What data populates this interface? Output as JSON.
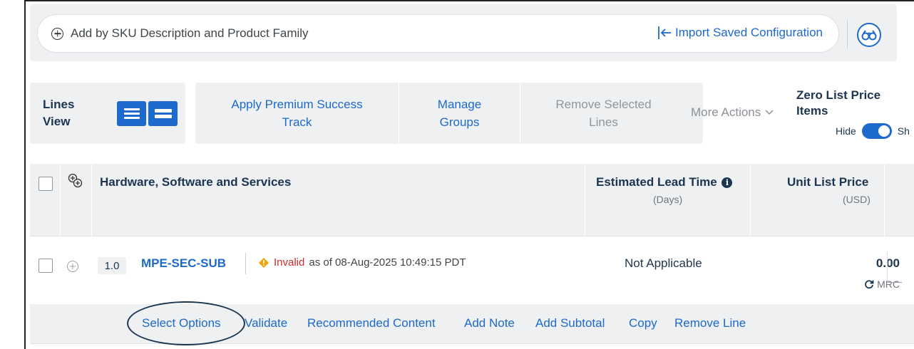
{
  "search": {
    "placeholder": "Add by SKU Description and Product Family",
    "import_label": "Import Saved Configuration"
  },
  "toolbar": {
    "lines_view_line1": "Lines",
    "lines_view_line2": "View",
    "apply_premium_line1": "Apply Premium Success",
    "apply_premium_line2": "Track",
    "manage_groups_line1": "Manage",
    "manage_groups_line2": "Groups",
    "remove_selected_line1": "Remove Selected",
    "remove_selected_line2": "Lines",
    "more_actions": "More Actions",
    "zero_list_line1": "Zero List Price",
    "zero_list_line2": "Items",
    "hide_label": "Hide",
    "show_label": "Sh"
  },
  "table": {
    "col_main": "Hardware, Software and Services",
    "col_lead": "Estimated Lead Time",
    "col_lead_sub": "(Days)",
    "col_price": "Unit List Price",
    "col_price_sub": "(USD)"
  },
  "row": {
    "line_number": "1.0",
    "sku": "MPE-SEC-SUB",
    "status_invalid": "Invalid",
    "status_rest": "as of 08-Aug-2025 10:49:15 PDT",
    "lead_time": "Not Applicable",
    "price": "0.00",
    "billing": "MRC"
  },
  "actions": {
    "select_options": "Select Options",
    "validate": "Validate",
    "recommended": "Recommended Content",
    "add_note": "Add Note",
    "add_subtotal": "Add Subtotal",
    "copy": "Copy",
    "remove_line": "Remove Line"
  },
  "colors": {
    "accent": "#1d69cc",
    "text_dark": "#1c3550",
    "panel_bg": "#eef0f2",
    "invalid": "#d32b2b",
    "warning": "#f0a30a"
  }
}
